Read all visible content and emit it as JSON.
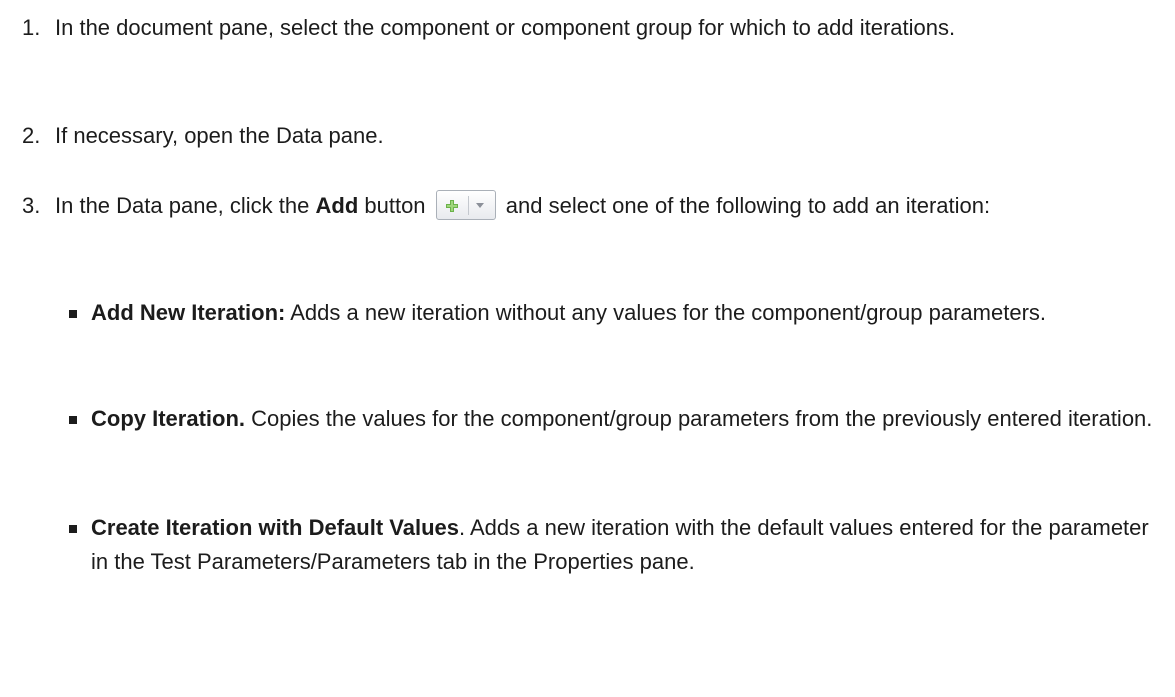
{
  "steps": [
    {
      "number": "1.",
      "text": "In the document pane, select the component or component group for which to add iterations."
    },
    {
      "number": "2.",
      "text": "If necessary, open the Data pane."
    },
    {
      "number": "3.",
      "text_before": "In the Data pane, click the ",
      "bold": "Add",
      "text_mid": " button ",
      "text_after": " and select one of the following to add an iteration:",
      "add_button_icon": "plus-icon",
      "add_button_dropdown_icon": "chevron-down-icon",
      "sub_items": [
        {
          "bold": "Add New Iteration:",
          "text": " Adds a new iteration without any values for the component/group parameters."
        },
        {
          "bold": "Copy Iteration.",
          "text": " Copies the values for the component/group parameters from the previously entered iteration."
        },
        {
          "bold": "Create Iteration with Default Values",
          "text": ". Adds a new iteration with the default values entered for the parameter in the Test Parameters/Parameters tab in the Properties pane."
        }
      ]
    }
  ],
  "colors": {
    "text": "#1c1c1c",
    "plus_icon": "#6bb24a",
    "button_border": "#aab0b8"
  }
}
